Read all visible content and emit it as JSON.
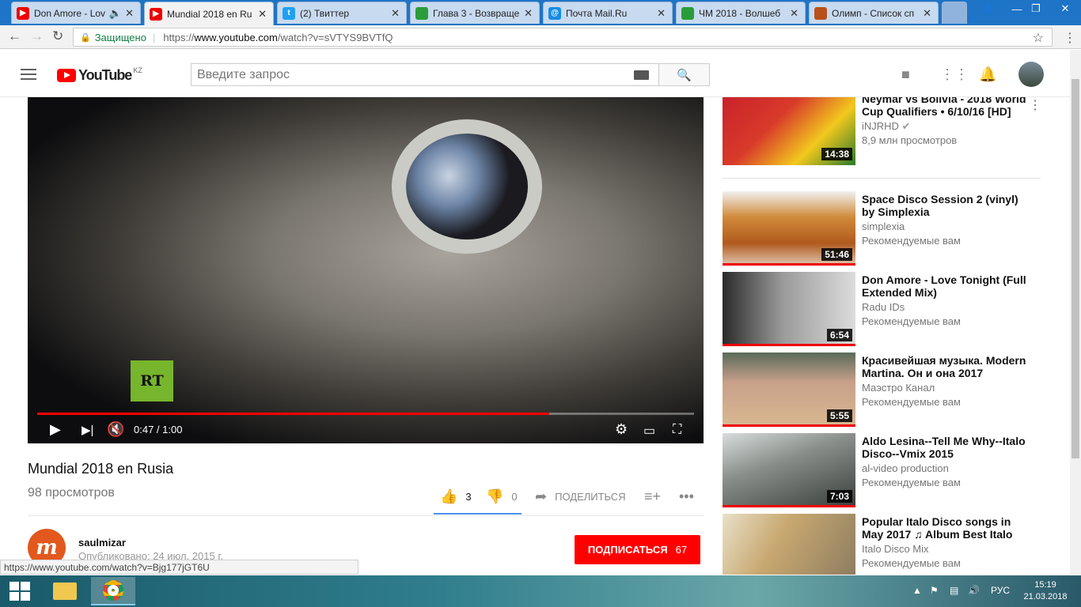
{
  "browser": {
    "tabs": [
      {
        "title": "Don Amore - Lov",
        "color": "#e00",
        "active": false
      },
      {
        "title": "Mundial 2018 en Ru",
        "color": "#e00",
        "active": true
      },
      {
        "title": "(2) Твиттер",
        "color": "#1da1f2",
        "active": false
      },
      {
        "title": "Глава 3 - Возвраще",
        "color": "#2a9d3a",
        "active": false
      },
      {
        "title": "Почта Mail.Ru",
        "color": "#168de2",
        "active": false
      },
      {
        "title": "ЧМ 2018 - Волшеб",
        "color": "#2a9d3a",
        "active": false
      },
      {
        "title": "Олимп - Список сп",
        "color": "#b8501c",
        "active": false
      }
    ],
    "close_glyph": "✕",
    "secure_label": "Защищено",
    "url_prefix": "https://",
    "url_host": "www.youtube.com",
    "url_path": "/watch?v=sVTYS9BVTfQ",
    "status_url": "https://www.youtube.com/watch?v=Bjg177jGT6U"
  },
  "youtube": {
    "logo_text": "YouTube",
    "country": "KZ",
    "search_placeholder": "Введите запрос"
  },
  "video": {
    "title": "Mundial 2018 en Rusia",
    "views": "98 просмотров",
    "time": "0:47 / 1:00",
    "progress": 0.78,
    "watermark": "RT",
    "likes": "3",
    "dislikes": "0",
    "share_label": "ПОДЕЛИТЬСЯ"
  },
  "channel": {
    "name": "saulmizar",
    "published": "Опубликовано: 24 июл. 2015 г.",
    "avatar_letter": "m",
    "subscribe_label": "ПОДПИСАТЬСЯ",
    "subscriber_count": "67"
  },
  "recommendations": [
    {
      "title": "Neymar vs Bolivia - 2018 World Cup Qualifiers • 6/10/16 [HD]",
      "channel": "iNJRHD",
      "meta": "8,9 млн просмотров",
      "duration": "14:38",
      "verified": true
    },
    {
      "title": "Space Disco Session 2 (vinyl) by Simplexia",
      "channel": "simplexia",
      "meta": "Рекомендуемые вам",
      "duration": "51:46"
    },
    {
      "title": "Don Amore - Love Tonight (Full Extended Mix)",
      "channel": "Radu IDs",
      "meta": "Рекомендуемые вам",
      "duration": "6:54"
    },
    {
      "title": "Красивейшая музыка. Modern Martina. Он и она 2017",
      "channel": "Маэстро Канал",
      "meta": "Рекомендуемые вам",
      "duration": "5:55"
    },
    {
      "title": "Aldo Lesina--Tell Me Why--Italo Disco--Vmix 2015",
      "channel": "al-video production",
      "meta": "Рекомендуемые вам",
      "duration": "7:03"
    },
    {
      "title": "Popular Italo Disco songs in May 2017 ♫ Album Best Italo",
      "channel": "Italo Disco Mix",
      "meta": "Рекомендуемые вам",
      "duration": ""
    }
  ],
  "taskbar": {
    "language": "РУС",
    "time": "15:19",
    "date": "21.03.2018"
  }
}
